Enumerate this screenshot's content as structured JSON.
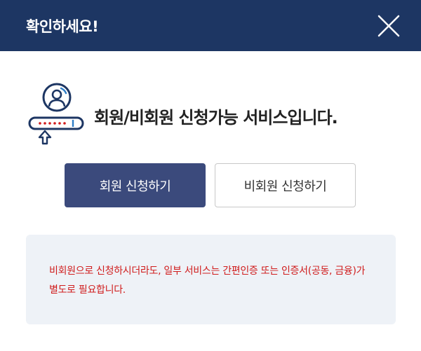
{
  "header": {
    "title": "확인하세요!"
  },
  "intro": {
    "icon": "member-application-icon",
    "text": "회원/비회원 신청가능 서비스입니다."
  },
  "buttons": {
    "member_label": "회원 신청하기",
    "nonmember_label": "비회원 신청하기"
  },
  "notice": {
    "text": "비회원으로 신청하시더라도, 일부 서비스는 간편인증 또는 인증서(공동, 금융)가 별도로 필요합니다."
  },
  "colors": {
    "header_bg": "#1d3663",
    "primary_button": "#3b4a7c",
    "notice_bg": "#eef2f7",
    "notice_text": "#d01c1c",
    "icon_navy": "#1d3663",
    "icon_blue": "#2f7ec7"
  }
}
